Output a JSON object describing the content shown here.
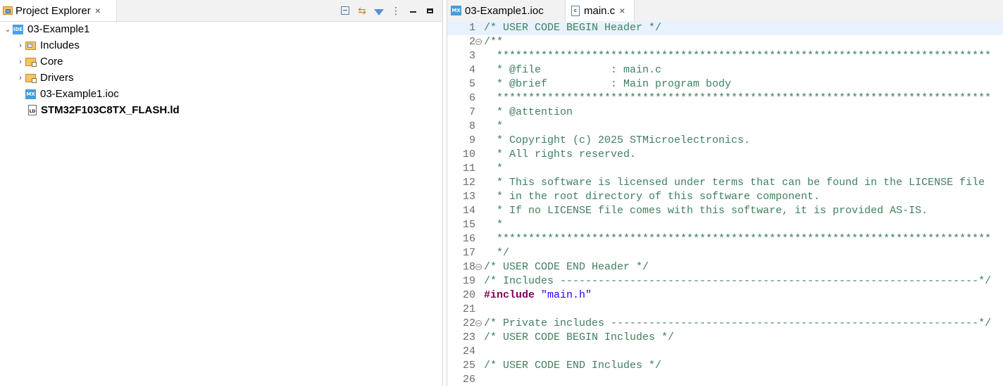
{
  "explorer": {
    "tab_label": "Project Explorer",
    "tab_close": "×",
    "toolbar": {
      "collapse_icon": "collapse-all-icon",
      "link_icon": "link-with-editor-icon",
      "filter_icon": "filter-icon",
      "menu_glyph": "⋮",
      "link_glyph": "⇆"
    },
    "tree": [
      {
        "label": "03-Example1",
        "icon": "ide-project-icon",
        "expanded": true,
        "level": 0
      },
      {
        "label": "Includes",
        "icon": "includes-folder-icon",
        "expanded": false,
        "level": 1
      },
      {
        "label": "Core",
        "icon": "source-folder-icon",
        "expanded": false,
        "level": 1
      },
      {
        "label": "Drivers",
        "icon": "source-folder-icon",
        "expanded": false,
        "level": 1
      },
      {
        "label": "03-Example1.ioc",
        "icon": "mx-file-icon",
        "level": 1
      },
      {
        "label": "STM32F103C8TX_FLASH.ld",
        "icon": "ld-file-icon",
        "level": 1
      }
    ],
    "icon_text": {
      "ide": "IDE",
      "mx": "MX",
      "ld": "LD"
    }
  },
  "editor": {
    "tabs": [
      {
        "label": "03-Example1.ioc",
        "icon": "mx-file-icon",
        "active": false
      },
      {
        "label": "main.c",
        "icon": "c-file-icon",
        "active": true,
        "close": "×"
      }
    ],
    "c_icon_text": "c",
    "lines": [
      {
        "n": "1",
        "text": "/* USER CODE BEGIN Header */"
      },
      {
        "n": "2",
        "text": "/**"
      },
      {
        "n": "3",
        "text": "  ******************************************************************************"
      },
      {
        "n": "4",
        "text": "  * @file           : main.c"
      },
      {
        "n": "5",
        "text": "  * @brief          : Main program body"
      },
      {
        "n": "6",
        "text": "  ******************************************************************************"
      },
      {
        "n": "7",
        "text": "  * @attention"
      },
      {
        "n": "8",
        "text": "  *"
      },
      {
        "n": "9",
        "text": "  * Copyright (c) 2025 STMicroelectronics."
      },
      {
        "n": "10",
        "text": "  * All rights reserved."
      },
      {
        "n": "11",
        "text": "  *"
      },
      {
        "n": "12",
        "text": "  * This software is licensed under terms that can be found in the LICENSE file"
      },
      {
        "n": "13",
        "text": "  * in the root directory of this software component."
      },
      {
        "n": "14",
        "text": "  * If no LICENSE file comes with this software, it is provided AS-IS."
      },
      {
        "n": "15",
        "text": "  *"
      },
      {
        "n": "16",
        "text": "  ******************************************************************************"
      },
      {
        "n": "17",
        "text": "  */"
      },
      {
        "n": "18",
        "text": "/* USER CODE END Header */"
      },
      {
        "n": "19",
        "text": "/* Includes ------------------------------------------------------------------*/"
      },
      {
        "n": "20",
        "kw": "#include",
        "str": "\"main.h\""
      },
      {
        "n": "21",
        "text": ""
      },
      {
        "n": "22",
        "text": "/* Private includes ----------------------------------------------------------*/"
      },
      {
        "n": "23",
        "text": "/* USER CODE BEGIN Includes */"
      },
      {
        "n": "24",
        "text": ""
      },
      {
        "n": "25",
        "text": "/* USER CODE END Includes */"
      },
      {
        "n": "26",
        "text": ""
      }
    ],
    "fold_glyph": "−"
  },
  "colors": {
    "comment": "#3f7f5f",
    "keyword": "#7f0055",
    "string": "#2a00ff",
    "current_line": "#e8f2fe"
  }
}
